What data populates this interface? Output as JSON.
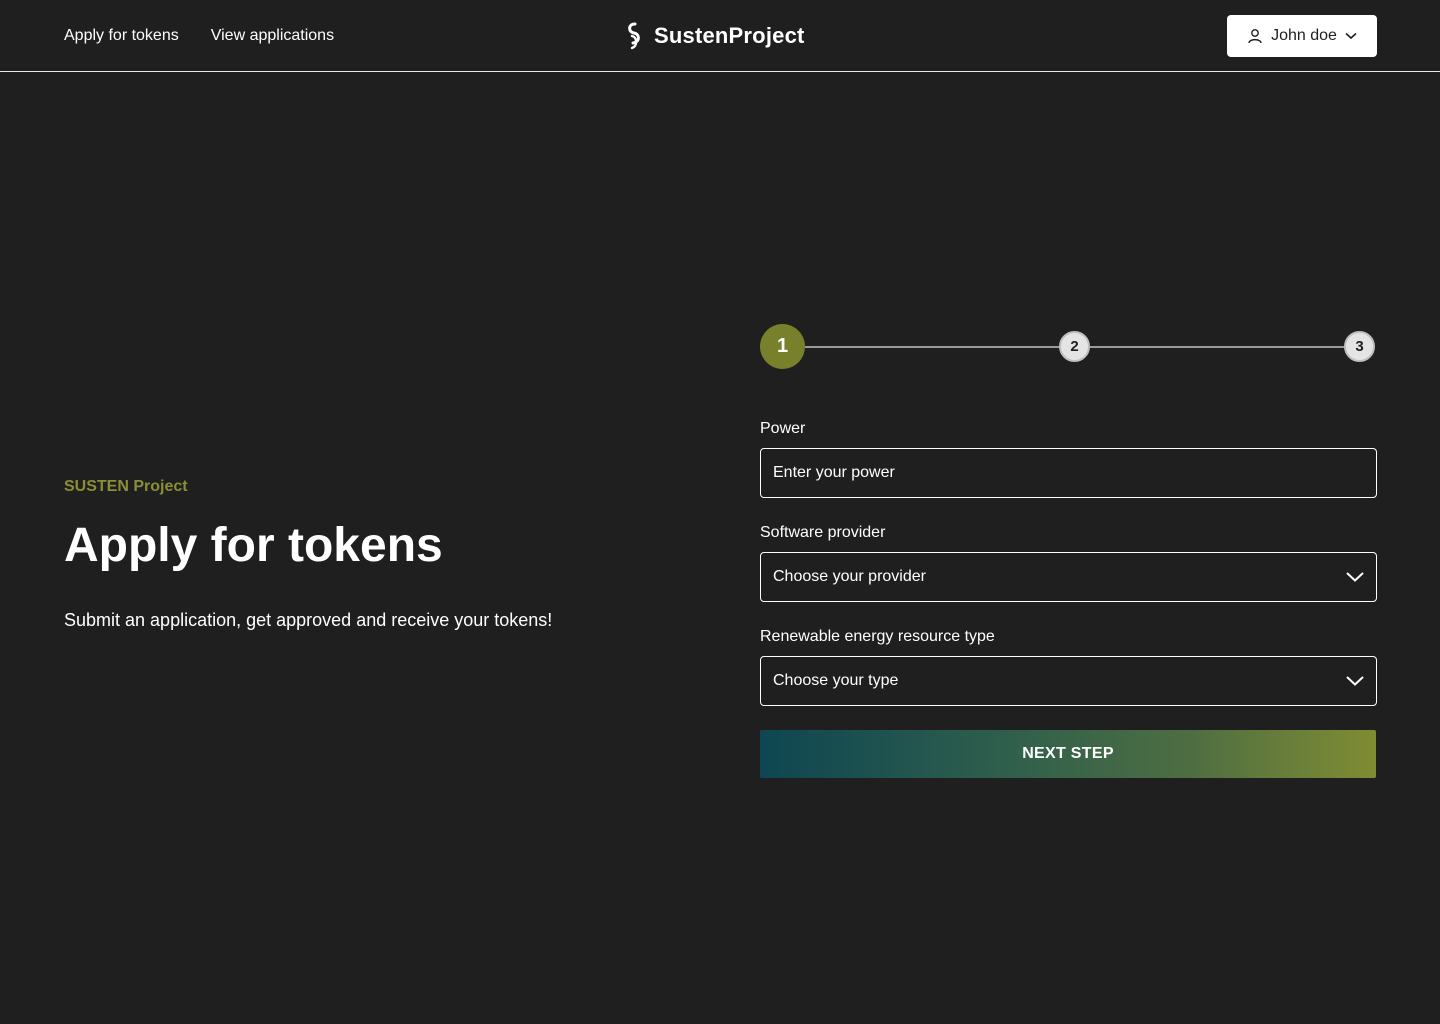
{
  "nav": {
    "apply_label": "Apply for tokens",
    "view_label": "View applications"
  },
  "brand": {
    "name": "SustenProject"
  },
  "user": {
    "name": "John doe"
  },
  "hero": {
    "eyebrow": "SUSTEN Project",
    "title": "Apply for tokens",
    "subtitle": "Submit an application, get approved and receive your tokens!"
  },
  "stepper": {
    "steps": [
      "1",
      "2",
      "3"
    ],
    "current": 1
  },
  "form": {
    "power": {
      "label": "Power",
      "placeholder": "Enter your power"
    },
    "provider": {
      "label": "Software provider",
      "value": "Choose your provider"
    },
    "resource": {
      "label": "Renewable energy resource type",
      "value": "Choose your type"
    },
    "next_label": "NEXT STEP"
  },
  "colors": {
    "background": "#1f1f1f",
    "accent": "#78802b",
    "eyebrow": "#8a8f34",
    "button_gradient_start": "#0e4652",
    "button_gradient_end": "#808c32"
  },
  "icons": [
    "brand-logo-icon",
    "user-icon",
    "chevron-down-icon"
  ]
}
